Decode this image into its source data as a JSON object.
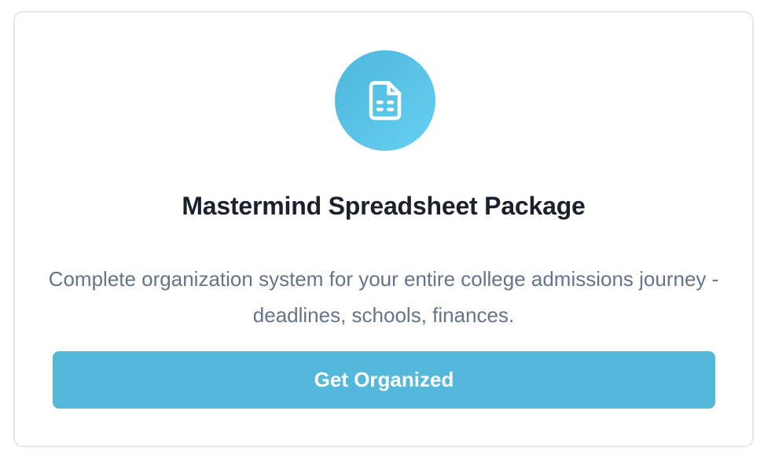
{
  "card": {
    "icon": "spreadsheet-document-icon",
    "title": "Mastermind Spreadsheet Package",
    "description": "Complete organization system for your entire college admissions journey - deadlines, schools, finances.",
    "button_label": "Get Organized"
  },
  "colors": {
    "icon_gradient_start": "#4cb6dc",
    "icon_gradient_end": "#67d1f2",
    "button_background": "#54b8da",
    "title_text": "#1a202c",
    "description_text": "#64748b"
  }
}
